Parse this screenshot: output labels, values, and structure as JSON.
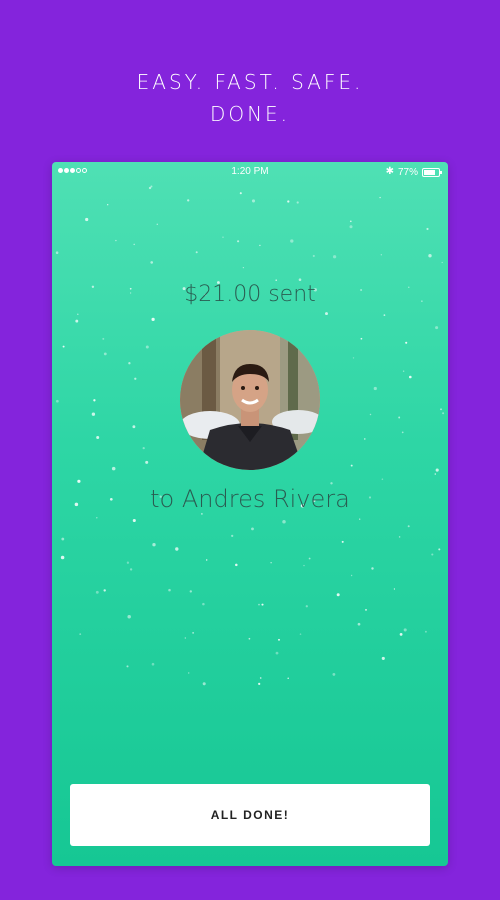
{
  "tagline": {
    "line1": "EASY. FAST. SAFE.",
    "line2": "DONE."
  },
  "status_bar": {
    "time": "1:20 PM",
    "battery": "77%",
    "battery_level": 0.77,
    "signal_bars": 3,
    "signal_total": 5,
    "bluetooth_icon": "bluetooth-icon"
  },
  "confirmation": {
    "amount_text": "$21.00 sent",
    "recipient_text": "to Andres Rivera",
    "avatar_icon": "recipient-avatar-photo"
  },
  "actions": {
    "done_label": "ALL DONE!"
  },
  "colors": {
    "background": "#8424dc",
    "screen_top": "#4fe0b4",
    "screen_bottom": "#16c794",
    "text_dark": "#2a5c51",
    "button": "#ffffff"
  }
}
